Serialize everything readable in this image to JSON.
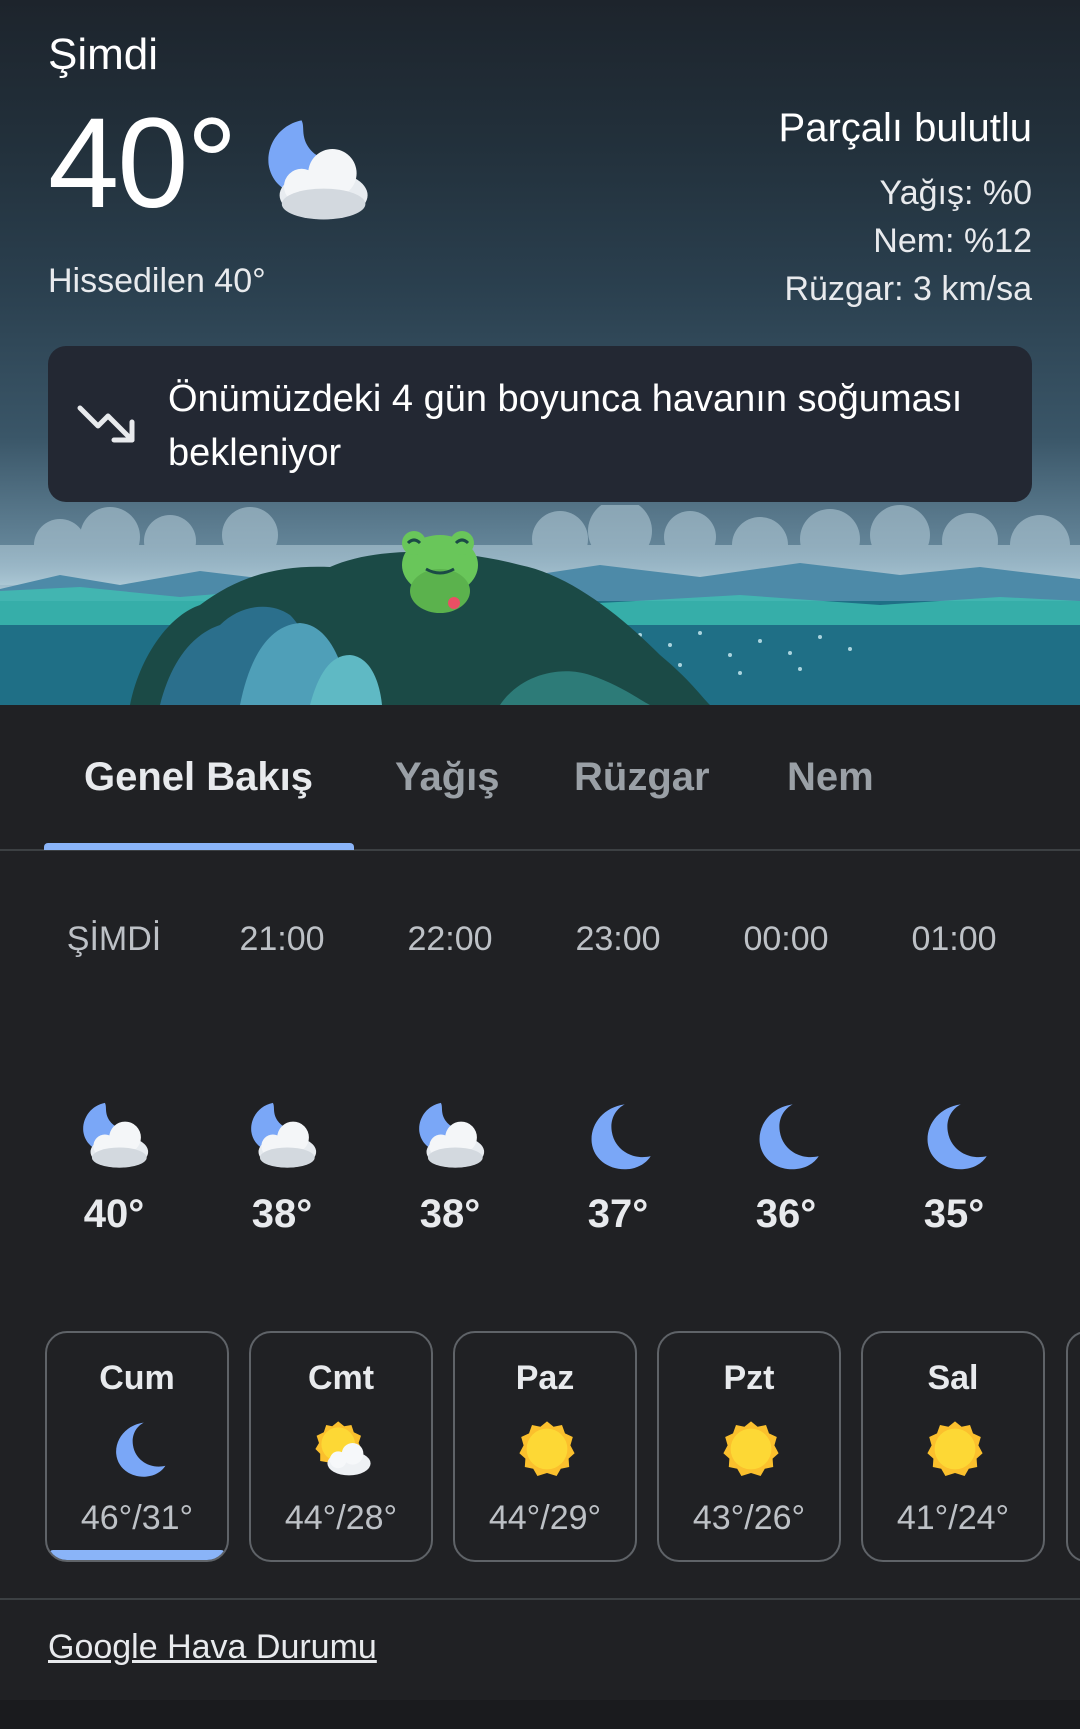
{
  "current": {
    "label": "Şimdi",
    "temperature": "40°",
    "feels_like": "Hissedilen 40°",
    "condition": "Parçalı bulutlu",
    "precipitation": "Yağış: %0",
    "humidity": "Nem: %12",
    "wind": "Rüzgar: 3 km/sa",
    "icon": "partly-cloudy-night-icon"
  },
  "alert": {
    "icon": "trending-down-icon",
    "text": "Önümüzdeki 4 gün boyunca havanın soğuması bekleniyor"
  },
  "tabs": [
    {
      "label": "Genel Bakış",
      "active": true
    },
    {
      "label": "Yağış",
      "active": false
    },
    {
      "label": "Rüzgar",
      "active": false
    },
    {
      "label": "Nem",
      "active": false
    }
  ],
  "hourly": [
    {
      "time": "ŞİMDİ",
      "temp": "40°",
      "icon": "partly-cloudy-night-icon"
    },
    {
      "time": "21:00",
      "temp": "38°",
      "icon": "partly-cloudy-night-icon"
    },
    {
      "time": "22:00",
      "temp": "38°",
      "icon": "partly-cloudy-night-icon"
    },
    {
      "time": "23:00",
      "temp": "37°",
      "icon": "moon-icon"
    },
    {
      "time": "00:00",
      "temp": "36°",
      "icon": "moon-icon"
    },
    {
      "time": "01:00",
      "temp": "35°",
      "icon": "moon-icon"
    }
  ],
  "daily": [
    {
      "day": "Cum",
      "temps": "46°/31°",
      "icon": "moon-icon",
      "selected": true
    },
    {
      "day": "Cmt",
      "temps": "44°/28°",
      "icon": "partly-cloudy-icon",
      "selected": false
    },
    {
      "day": "Paz",
      "temps": "44°/29°",
      "icon": "sun-icon",
      "selected": false
    },
    {
      "day": "Pzt",
      "temps": "43°/26°",
      "icon": "sun-icon",
      "selected": false
    },
    {
      "day": "Sal",
      "temps": "41°/24°",
      "icon": "sun-icon",
      "selected": false
    }
  ],
  "footer": {
    "link": "Google Hava Durumu"
  },
  "colors": {
    "accent": "#8ab4f8",
    "moon": "#7aa7f7",
    "sun": "#fbc02d",
    "background": "#202124"
  }
}
